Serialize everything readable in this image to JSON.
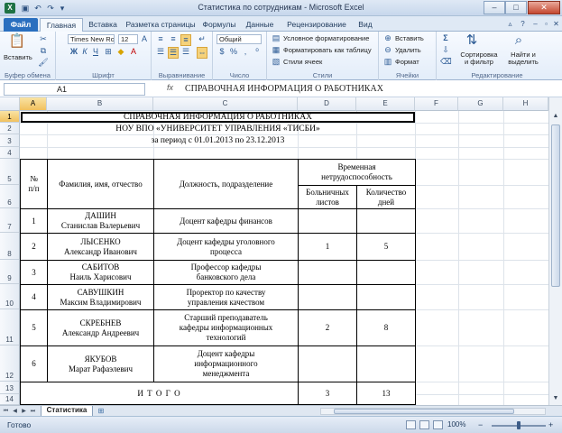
{
  "window": {
    "title": "Статистика по сотрудникам - Microsoft Excel",
    "minimize": "–",
    "maximize": "□",
    "close": "✕"
  },
  "ribbon_tabs": [
    "Файл",
    "Главная",
    "Вставка",
    "Разметка страницы",
    "Формулы",
    "Данные",
    "Рецензирование",
    "Вид"
  ],
  "ribbon": {
    "clipboard": {
      "paste": "Вставить",
      "label": "Буфер обмена"
    },
    "font": {
      "name": "Times New Roi",
      "size": "12",
      "label": "Шрифт"
    },
    "alignment": {
      "label": "Выравнивание"
    },
    "number": {
      "format": "Общий",
      "label": "Число"
    },
    "styles": {
      "conditional": "Условное форматирование",
      "format_table": "Форматировать как таблицу",
      "cell_styles": "Стили ячеек",
      "label": "Стили"
    },
    "cells": {
      "insert": "Вставить",
      "delete": "Удалить",
      "format": "Формат",
      "label": "Ячейки"
    },
    "editing": {
      "sort": "Сортировка и фильтр",
      "find": "Найти и выделить",
      "label": "Редактирование",
      "sum": "Σ"
    }
  },
  "formula_bar": {
    "name_box": "A1",
    "fx": "fx",
    "content": "СПРАВОЧНАЯ ИНФОРМАЦИЯ О РАБОТНИКАХ"
  },
  "columns": [
    "A",
    "B",
    "C",
    "D",
    "E",
    "F",
    "G",
    "H"
  ],
  "rows": [
    "1",
    "2",
    "3",
    "4",
    "5",
    "6",
    "7",
    "8",
    "9",
    "10",
    "11",
    "12",
    "13",
    "14"
  ],
  "sheet": {
    "title": "СПРАВОЧНАЯ ИНФОРМАЦИЯ О РАБОТНИКАХ",
    "org": "НОУ ВПО «УНИВЕРСИТЕТ УПРАВЛЕНИЯ «ТИСБИ»",
    "period": "за период с 01.01.2013 по 23.12.2013",
    "headers": {
      "num": "№ п/п",
      "name": "Фамилия, имя, отчество",
      "position": "Должность, подразделение",
      "disability": "Временная нетрудоспособность",
      "sick": "Больничных листов",
      "days": "Количество дней"
    },
    "employees": [
      {
        "num": "1",
        "surname": "ДАШИН",
        "given": "Станислав Валерьевич",
        "position": "Доцент кафедры финансов",
        "sick": "",
        "days": ""
      },
      {
        "num": "2",
        "surname": "ЛЫСЕНКО",
        "given": "Александр Иванович",
        "position": "Доцент кафедры уголовного процесса",
        "sick": "1",
        "days": "5"
      },
      {
        "num": "3",
        "surname": "САБИТОВ",
        "given": "Наиль Харисович",
        "position": "Профессор кафедры банковского дела",
        "sick": "",
        "days": ""
      },
      {
        "num": "4",
        "surname": "САВУШКИН",
        "given": "Максим Владимирович",
        "position": "Проректор по качеству управления качеством",
        "sick": "",
        "days": ""
      },
      {
        "num": "5",
        "surname": "СКРЕБНЕВ",
        "given": "Александр Андреевич",
        "position": "Старший преподаватель кафедры информационных технологий",
        "sick": "2",
        "days": "8"
      },
      {
        "num": "6",
        "surname": "ЯКУБОВ",
        "given": "Марат Рафаэлевич",
        "position": "Доцент кафедры информационного менеджмента",
        "sick": "",
        "days": ""
      }
    ],
    "total": {
      "label": "И Т О Г О",
      "sick": "3",
      "days": "13"
    }
  },
  "sheet_tabs": {
    "active": "Статистика"
  },
  "status": {
    "ready": "Готово",
    "zoom": "100%",
    "zoom_minus": "−",
    "zoom_plus": "+"
  }
}
